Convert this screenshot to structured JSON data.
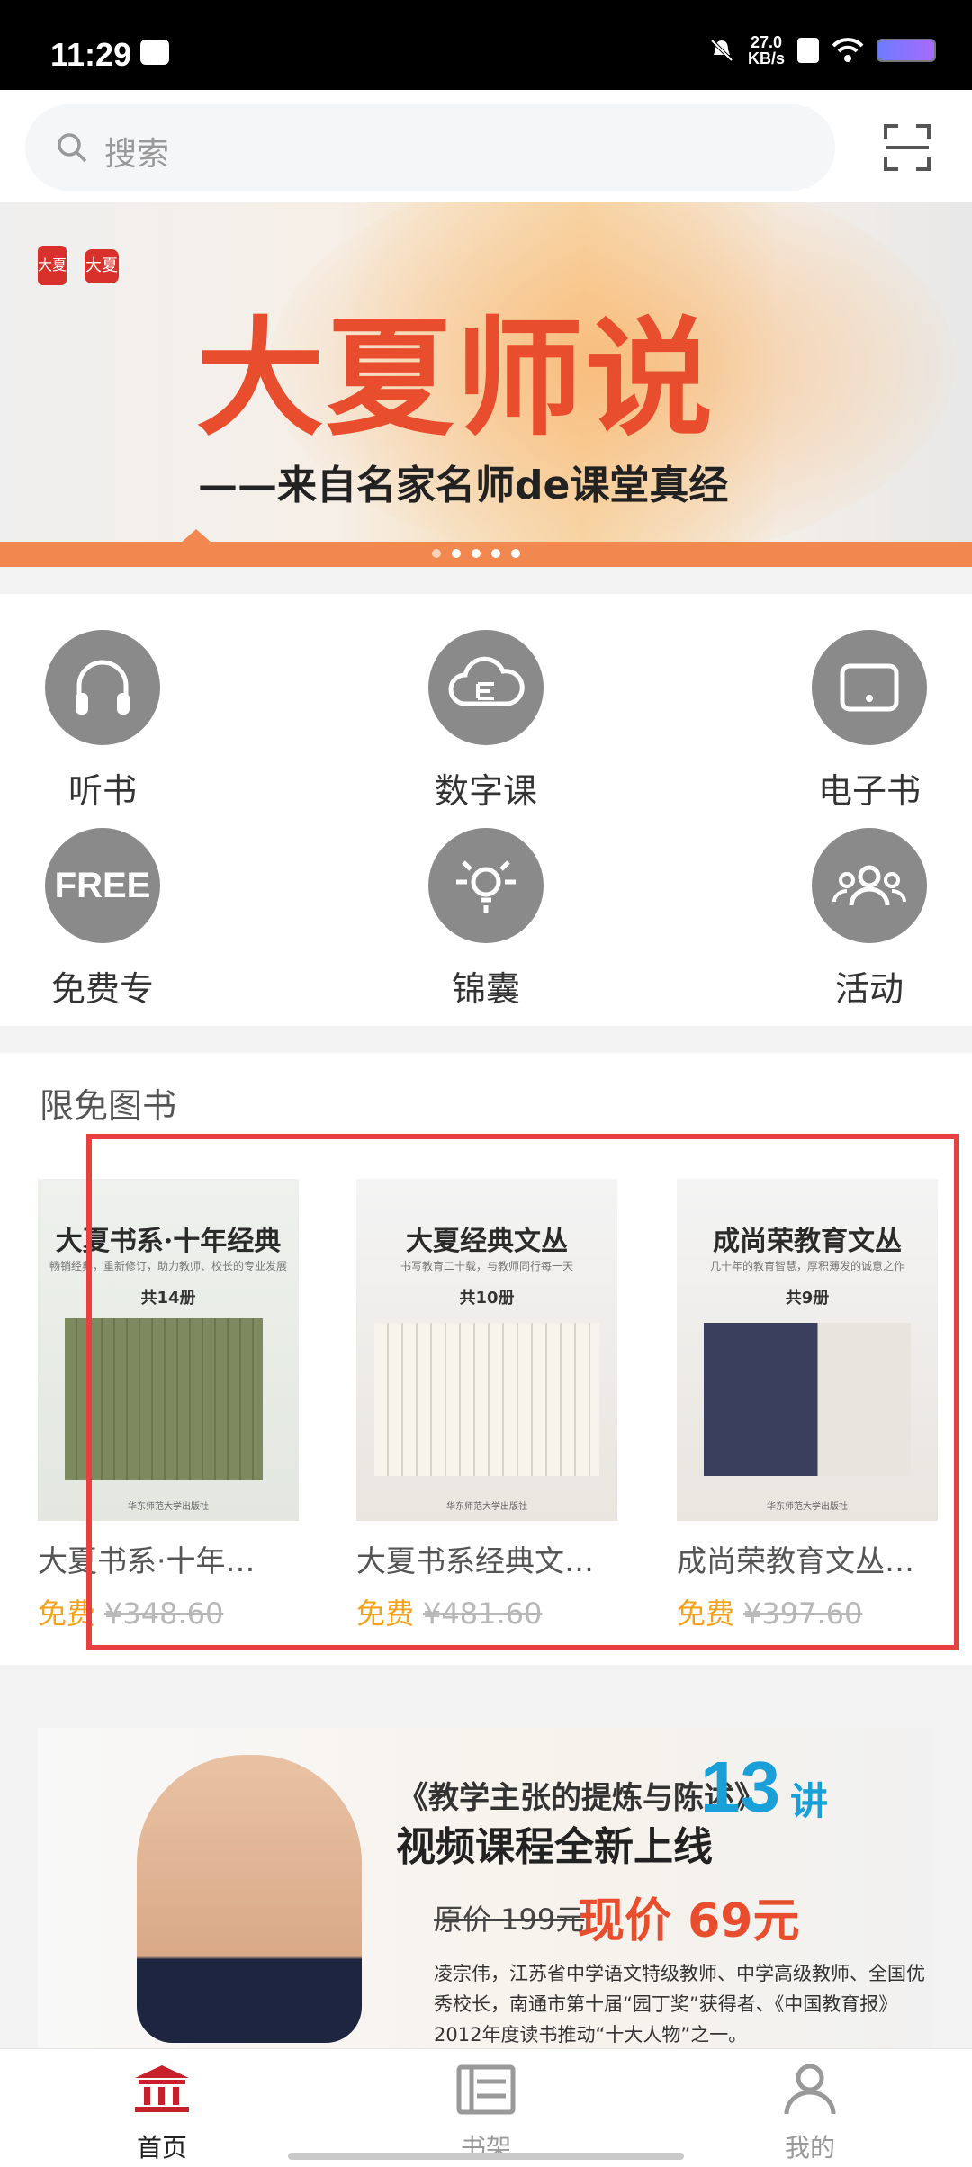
{
  "status_bar": {
    "time": "11:29",
    "speed_value": "27.0",
    "speed_unit": "KB/s"
  },
  "search": {
    "placeholder": "搜索",
    "search_icon": "search-icon",
    "scan_icon": "scan-icon"
  },
  "banner": {
    "logo_small_1": "大夏",
    "logo_small_2": "大夏",
    "title": "大夏师说",
    "subtitle": "——来自名家名师de课堂真经",
    "pages": 5,
    "active_page": 1
  },
  "menu": {
    "items": [
      {
        "label": "听书",
        "icon": "headphones-icon"
      },
      {
        "label": "数字课",
        "icon": "cloud-course-icon"
      },
      {
        "label": "电子书",
        "icon": "tablet-icon"
      },
      {
        "label": "免费专",
        "icon": "free-icon",
        "icon_text": "FREE"
      },
      {
        "label": "锦囊",
        "icon": "lightbulb-icon"
      },
      {
        "label": "活动",
        "icon": "people-icon"
      }
    ]
  },
  "free_books": {
    "heading": "限免图书",
    "books": [
      {
        "name": "大夏书系·十年…",
        "free_label": "免费",
        "original_price": "¥348.60",
        "cover_title": "大夏书系·十年经典",
        "cover_subtitle": "畅销经典，重新修订，助力教师、校长的专业发展",
        "cover_count": "共14册",
        "cover_publisher": "华东师范大学出版社"
      },
      {
        "name": "大夏书系经典文…",
        "free_label": "免费",
        "original_price": "¥481.60",
        "cover_title": "大夏经典文丛",
        "cover_subtitle": "书写教育二十载，与教师同行每一天",
        "cover_count": "共10册",
        "cover_publisher": "华东师范大学出版社"
      },
      {
        "name": "成尚荣教育文丛…",
        "free_label": "免费",
        "original_price": "¥397.60",
        "cover_title": "成尚荣教育文丛",
        "cover_subtitle": "几十年的教育智慧，厚积薄发的诚意之作",
        "cover_count": "共9册",
        "cover_publisher": "华东师范大学出版社"
      }
    ]
  },
  "ad": {
    "line1": "《教学主张的提炼与陈述》",
    "number": "13",
    "unit": "讲",
    "line2": "视频课程全新上线",
    "original": "原价 199元",
    "now": "现价 69元",
    "description": "凌宗伟，江苏省中学语文特级教师、中学高级教师、全国优秀校长，南通市第十届“园丁奖”获得者、《中国教育报》2012年度读书推动“十大人物”之一。"
  },
  "tabbar": {
    "tabs": [
      {
        "label": "首页",
        "icon": "home-icon",
        "active": true
      },
      {
        "label": "书架",
        "icon": "bookshelf-icon",
        "active": false
      },
      {
        "label": "我的",
        "icon": "profile-icon",
        "active": false
      }
    ]
  },
  "colors": {
    "accent": "#e84e2e",
    "active_tab": "#c8202a",
    "free": "#f4a21b",
    "highlight_box": "#e84040"
  }
}
